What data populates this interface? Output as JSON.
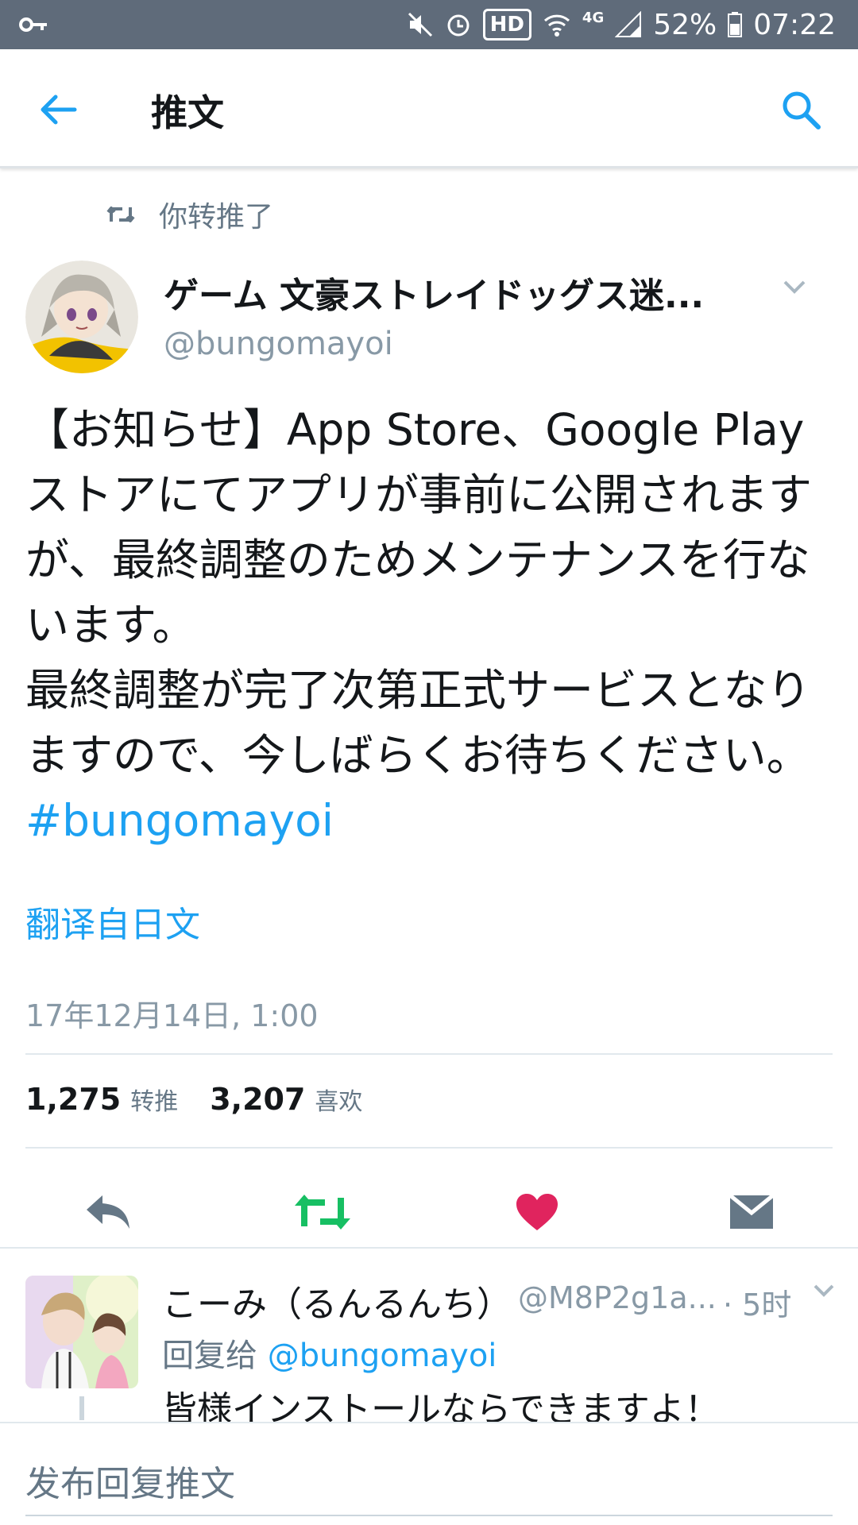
{
  "status_bar": {
    "battery": "52%",
    "time": "07:22",
    "hd": "HD",
    "network": "4G"
  },
  "header": {
    "title": "推文"
  },
  "retweet_context": {
    "label": "你转推了"
  },
  "tweet": {
    "author_name": "ゲーム 文豪ストレイドッグス迷...",
    "author_handle": "@bungomayoi",
    "text": "【お知らせ】App Store、Google Playストアにてアプリが事前に公開されますが、最終調整のためメンテナンスを行ないます。\n最終調整が完了次第正式サービスとなりますので、今しばらくお待ちください。",
    "hashtag": "#bungomayoi",
    "translate_label": "翻译自日文",
    "timestamp": "17年12月14日, 1:00",
    "retweet_count": "1,275",
    "retweet_label": "转推",
    "like_count": "3,207",
    "like_label": "喜欢"
  },
  "reply": {
    "name": "こーみ（るんるんち）",
    "handle": "@M8P2g1a...",
    "time": "· 5时",
    "reply_to_prefix": "回复给",
    "reply_to_mention": "@bungomayoi",
    "text": "皆様インストールならできますよ！"
  },
  "compose": {
    "placeholder": "发布回复推文"
  },
  "colors": {
    "accent": "#1da1f2",
    "retweet_green": "#17bf63",
    "like_red": "#e0245e",
    "status_bar": "#5f6b7a"
  }
}
